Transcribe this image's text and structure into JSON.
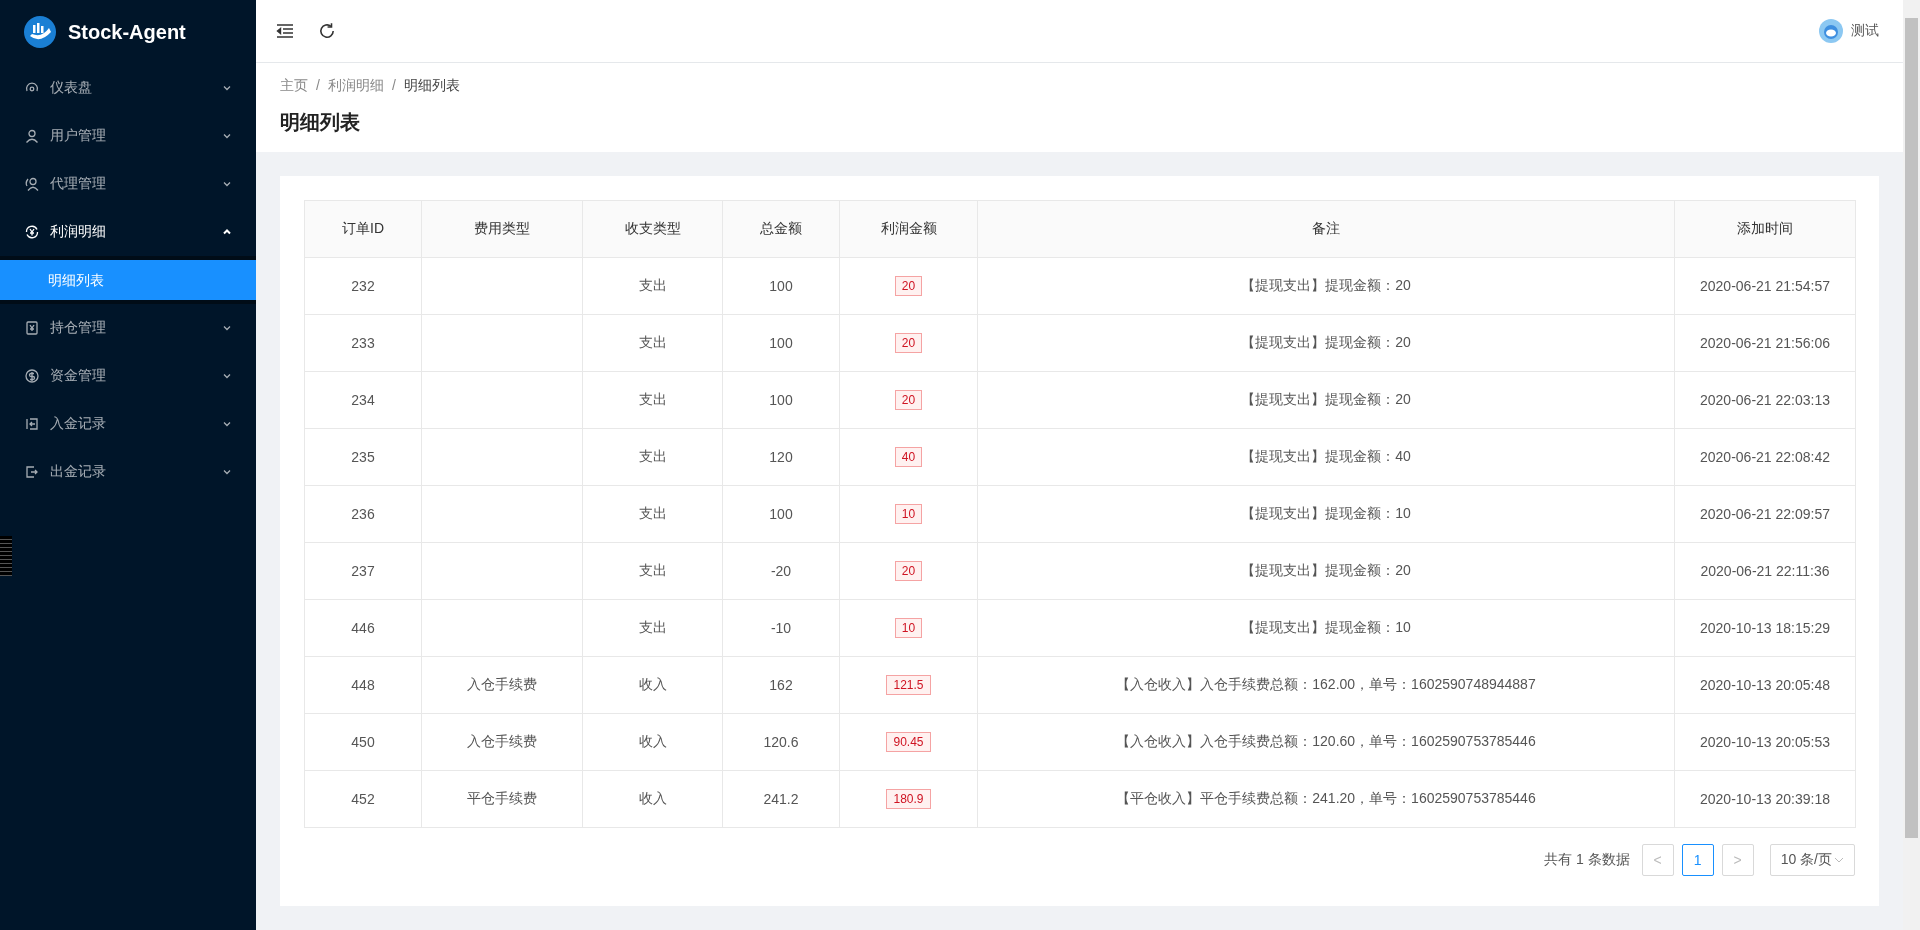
{
  "brand": {
    "title": "Stock-Agent"
  },
  "sidebar": {
    "items": [
      {
        "label": "仪表盘",
        "expanded": false
      },
      {
        "label": "用户管理",
        "expanded": false
      },
      {
        "label": "代理管理",
        "expanded": false
      },
      {
        "label": "利润明细",
        "expanded": true,
        "children": [
          {
            "label": "明细列表",
            "selected": true
          }
        ]
      },
      {
        "label": "持仓管理",
        "expanded": false
      },
      {
        "label": "资金管理",
        "expanded": false
      },
      {
        "label": "入金记录",
        "expanded": false
      },
      {
        "label": "出金记录",
        "expanded": false
      }
    ]
  },
  "header": {
    "user": "测试"
  },
  "breadcrumb": {
    "items": [
      "主页",
      "利润明细",
      "明细列表"
    ],
    "separators": [
      "/",
      "/"
    ]
  },
  "page_title": "明细列表",
  "table": {
    "columns": [
      "订单ID",
      "费用类型",
      "收支类型",
      "总金额",
      "利润金额",
      "备注",
      "添加时间"
    ],
    "rows": [
      [
        "232",
        "",
        "支出",
        "100",
        "20",
        "【提现支出】提现金额：20",
        "2020-06-21 21:54:57"
      ],
      [
        "233",
        "",
        "支出",
        "100",
        "20",
        "【提现支出】提现金额：20",
        "2020-06-21 21:56:06"
      ],
      [
        "234",
        "",
        "支出",
        "100",
        "20",
        "【提现支出】提现金额：20",
        "2020-06-21 22:03:13"
      ],
      [
        "235",
        "",
        "支出",
        "120",
        "40",
        "【提现支出】提现金额：40",
        "2020-06-21 22:08:42"
      ],
      [
        "236",
        "",
        "支出",
        "100",
        "10",
        "【提现支出】提现金额：10",
        "2020-06-21 22:09:57"
      ],
      [
        "237",
        "",
        "支出",
        "-20",
        "20",
        "【提现支出】提现金额：20",
        "2020-06-21 22:11:36"
      ],
      [
        "446",
        "",
        "支出",
        "-10",
        "10",
        "【提现支出】提现金额：10",
        "2020-10-13 18:15:29"
      ],
      [
        "448",
        "入仓手续费",
        "收入",
        "162",
        "121.5",
        "【入仓收入】入仓手续费总额：162.00，单号：1602590748944887",
        "2020-10-13 20:05:48"
      ],
      [
        "450",
        "入仓手续费",
        "收入",
        "120.6",
        "90.45",
        "【入仓收入】入仓手续费总额：120.60，单号：1602590753785446",
        "2020-10-13 20:05:53"
      ],
      [
        "452",
        "平仓手续费",
        "收入",
        "241.2",
        "180.9",
        "【平仓收入】平仓手续费总额：241.20，单号：1602590753785446",
        "2020-10-13 20:39:18"
      ]
    ]
  },
  "pagination": {
    "total_text": "共有 1 条数据",
    "prev": "<",
    "pages": [
      {
        "label": "1",
        "selected": true
      }
    ],
    "next": ">",
    "page_size": "10 条/页"
  }
}
